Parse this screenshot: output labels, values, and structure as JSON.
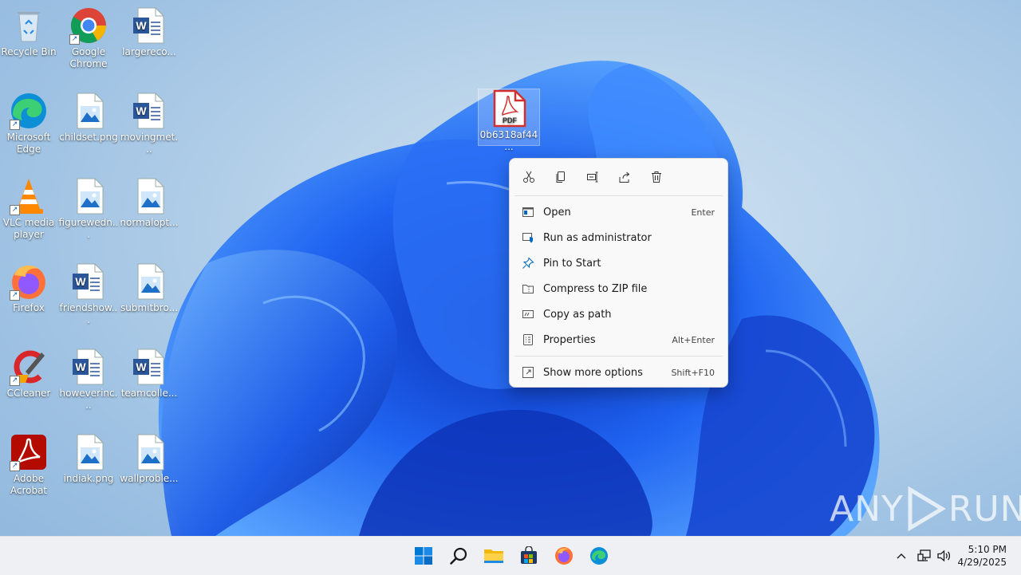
{
  "desktop": {
    "icons": [
      {
        "label": "Recycle Bin",
        "icon": "recycle-bin-icon"
      },
      {
        "label": "Google Chrome",
        "icon": "chrome-icon"
      },
      {
        "label": "largereco...",
        "icon": "word-doc-icon"
      },
      {
        "label": "Microsoft Edge",
        "icon": "edge-icon"
      },
      {
        "label": "childset.png",
        "icon": "image-file-icon"
      },
      {
        "label": "movingmet...",
        "icon": "word-doc-icon"
      },
      {
        "label": "VLC media player",
        "icon": "vlc-icon"
      },
      {
        "label": "figurewedn...",
        "icon": "image-file-icon"
      },
      {
        "label": "normalopt...",
        "icon": "image-file-icon"
      },
      {
        "label": "Firefox",
        "icon": "firefox-icon"
      },
      {
        "label": "friendshow...",
        "icon": "word-doc-icon"
      },
      {
        "label": "submitbro...",
        "icon": "image-file-icon"
      },
      {
        "label": "CCleaner",
        "icon": "ccleaner-icon"
      },
      {
        "label": "howeverinc...",
        "icon": "word-doc-icon"
      },
      {
        "label": "teamcolle...",
        "icon": "word-doc-icon"
      },
      {
        "label": "Adobe Acrobat",
        "icon": "acrobat-icon"
      },
      {
        "label": "indiak.png",
        "icon": "image-file-icon"
      },
      {
        "label": "wallproble...",
        "icon": "image-file-icon"
      }
    ],
    "selected_file": {
      "label": "0b6318af44...",
      "icon": "pdf-file-icon",
      "badge": "PDF"
    }
  },
  "context_menu": {
    "toolbar": [
      {
        "name": "cut",
        "icon": "scissors-icon"
      },
      {
        "name": "copy",
        "icon": "copy-icon"
      },
      {
        "name": "rename",
        "icon": "rename-icon"
      },
      {
        "name": "share",
        "icon": "share-icon"
      },
      {
        "name": "delete",
        "icon": "trash-icon"
      }
    ],
    "items": [
      {
        "label": "Open",
        "shortcut": "Enter",
        "icon": "open-icon"
      },
      {
        "label": "Run as administrator",
        "shortcut": "",
        "icon": "shield-icon"
      },
      {
        "label": "Pin to Start",
        "shortcut": "",
        "icon": "pin-icon"
      },
      {
        "label": "Compress to ZIP file",
        "shortcut": "",
        "icon": "zip-folder-icon"
      },
      {
        "label": "Copy as path",
        "shortcut": "",
        "icon": "path-icon"
      },
      {
        "label": "Properties",
        "shortcut": "Alt+Enter",
        "icon": "properties-icon"
      },
      {
        "label": "Show more options",
        "shortcut": "Shift+F10",
        "icon": "more-options-icon"
      }
    ]
  },
  "taskbar": {
    "apps": [
      "start-icon",
      "search-icon",
      "file-explorer-icon",
      "store-icon",
      "firefox-icon",
      "edge-icon"
    ],
    "tray": [
      "chevron-up-icon",
      "network-icon",
      "volume-icon"
    ],
    "time": "5:10 PM",
    "date": "4/29/2025"
  },
  "watermark": {
    "text_left": "ANY",
    "text_right": "RUN"
  },
  "colors": {
    "accent": "#0067c0",
    "wallpaper_blue": "#1a5fe0",
    "pdf_red": "#d32f2f"
  }
}
